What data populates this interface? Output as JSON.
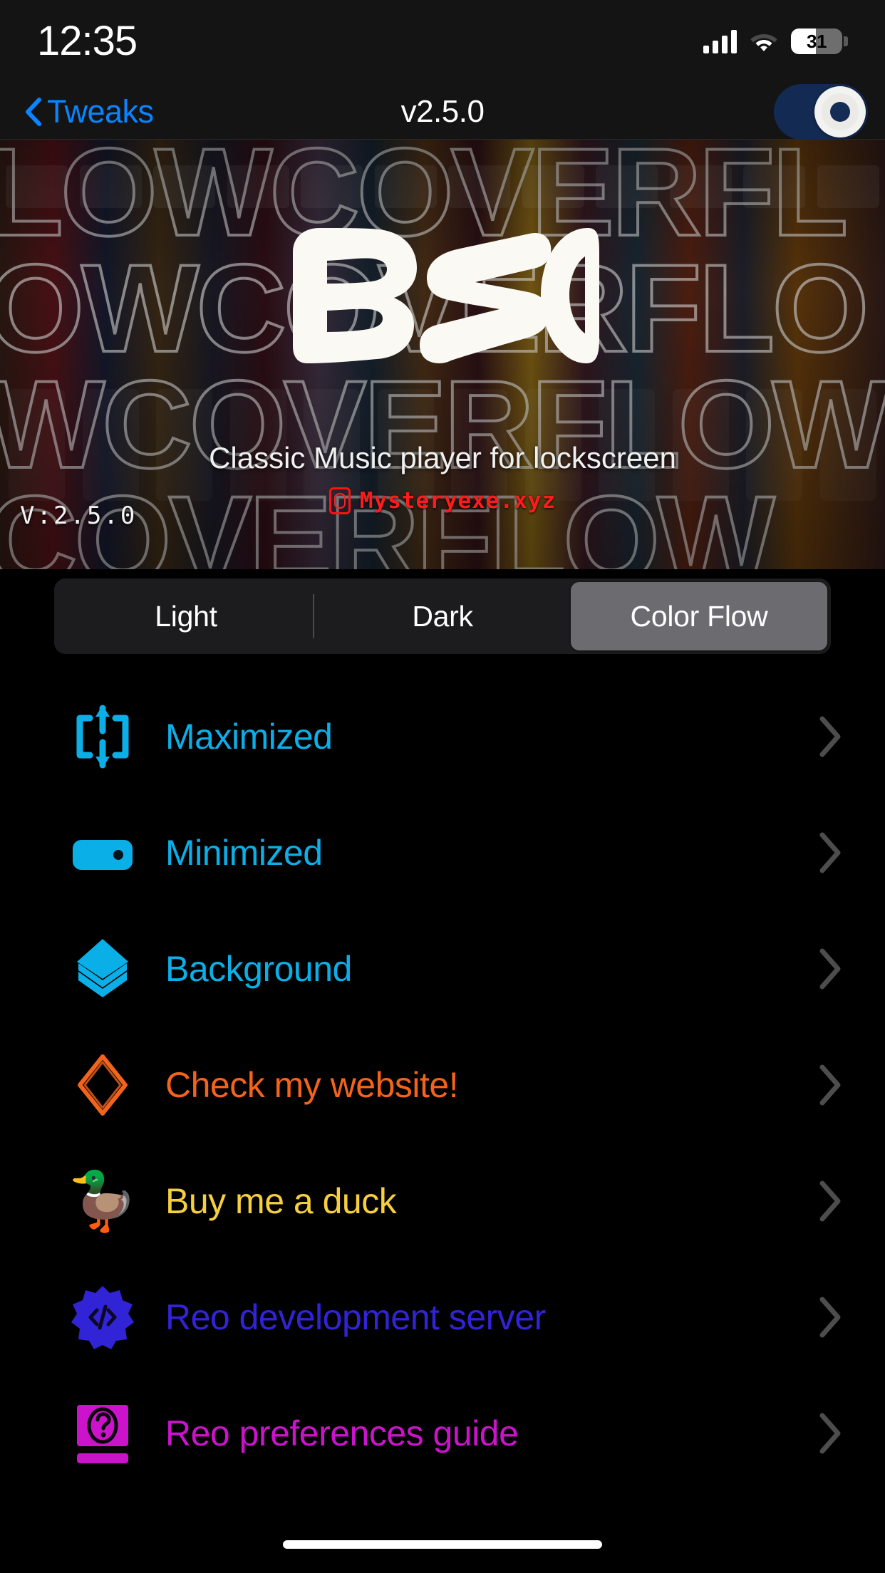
{
  "status_bar": {
    "time": "12:35",
    "battery_percent": "31",
    "signal_icon": "cellular-signal-icon",
    "wifi_icon": "wifi-icon",
    "battery_icon": "battery-icon"
  },
  "nav_bar": {
    "back_label": "Tweaks",
    "back_icon": "chevron-left-icon",
    "title": "v2.5.0",
    "toggle_enabled": true,
    "toggle_icon": "power-toggle-icon"
  },
  "banner": {
    "collage_text": "LOWCOVERFLOWCOVERFLOWCOVERFLOWCOVERFLOW",
    "logo_text": "REO",
    "tagline": "Classic Music player for lockscreen",
    "credit": "Mysteryexe.xyz",
    "credit_icon": "mystery-badge-icon",
    "version": "V:2.5.0"
  },
  "segmented_control": {
    "options": [
      {
        "label": "Light",
        "selected": false
      },
      {
        "label": "Dark",
        "selected": false
      },
      {
        "label": "Color Flow",
        "selected": true
      }
    ]
  },
  "list": {
    "items": [
      {
        "label": "Maximized",
        "icon": "expand-arrows-icon",
        "color": "#0bafe8"
      },
      {
        "label": "Minimized",
        "icon": "minimized-pill-icon",
        "color": "#0bafe8"
      },
      {
        "label": "Background",
        "icon": "layers-stack-icon",
        "color": "#0bafe8"
      },
      {
        "label": "Check my website!",
        "icon": "diamond-outline-icon",
        "color": "#f4631a"
      },
      {
        "label": "Buy me a duck",
        "icon": "rubber-duck-icon",
        "color": "#f5cf3e"
      },
      {
        "label": "Reo development server",
        "icon": "gear-code-icon",
        "color": "#3124d6"
      },
      {
        "label": "Reo preferences guide",
        "icon": "book-question-icon",
        "color": "#cc13cc"
      }
    ],
    "chevron_icon": "chevron-right-icon"
  },
  "home_indicator": {
    "icon": "home-indicator-bar"
  },
  "colors": {
    "background": "#000000",
    "bar_background": "#141414",
    "accent_blue": "#0a84ff",
    "accent_cyan": "#0bafe8",
    "segment_track": "#1c1c1e",
    "segment_selected": "#6b6b70",
    "toggle_track": "#132a52",
    "credit_red": "#ff1b1b"
  }
}
